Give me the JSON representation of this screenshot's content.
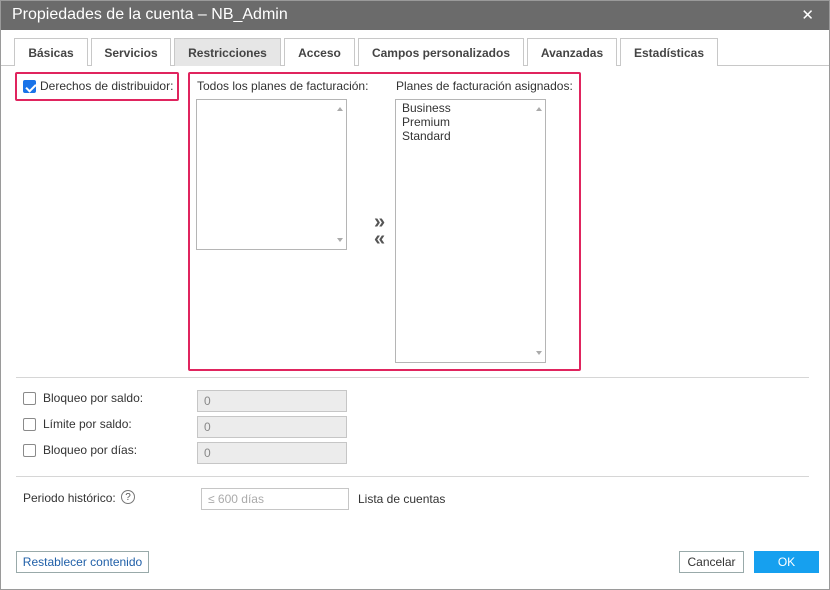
{
  "window": {
    "title": "Propiedades de la cuenta – NB_Admin",
    "close_icon": "close-icon"
  },
  "tabs": [
    {
      "label": "Básicas",
      "active": false
    },
    {
      "label": "Servicios",
      "active": false
    },
    {
      "label": "Restricciones",
      "active": true
    },
    {
      "label": "Acceso",
      "active": false
    },
    {
      "label": "Campos personalizados",
      "active": false
    },
    {
      "label": "Avanzadas",
      "active": false
    },
    {
      "label": "Estadísticas",
      "active": false
    }
  ],
  "distributor": {
    "label": "Derechos de distribuidor:",
    "checked": true
  },
  "billing": {
    "all_label": "Todos los planes de facturación:",
    "all_items": [],
    "assigned_label": "Planes de facturación asignados:",
    "assigned_items": [
      "Business",
      "Premium",
      "Standard"
    ],
    "move_right": "»",
    "move_left": "«"
  },
  "restrictions": [
    {
      "label": "Bloqueo por saldo:",
      "checked": false,
      "value": "0"
    },
    {
      "label": "Límite por saldo:",
      "checked": false,
      "value": "0"
    },
    {
      "label": "Bloqueo por días:",
      "checked": false,
      "value": "0"
    }
  ],
  "history": {
    "label": "Periodo histórico:",
    "help_icon": "?",
    "placeholder": "≤ 600 días",
    "link_label": "Lista de cuentas"
  },
  "footer": {
    "reset_label": "Restablecer contenido",
    "cancel_label": "Cancelar",
    "ok_label": "OK"
  },
  "colors": {
    "highlight": "#e0245e",
    "accent": "#16a0ef",
    "titlebar": "#6b6b6b"
  }
}
